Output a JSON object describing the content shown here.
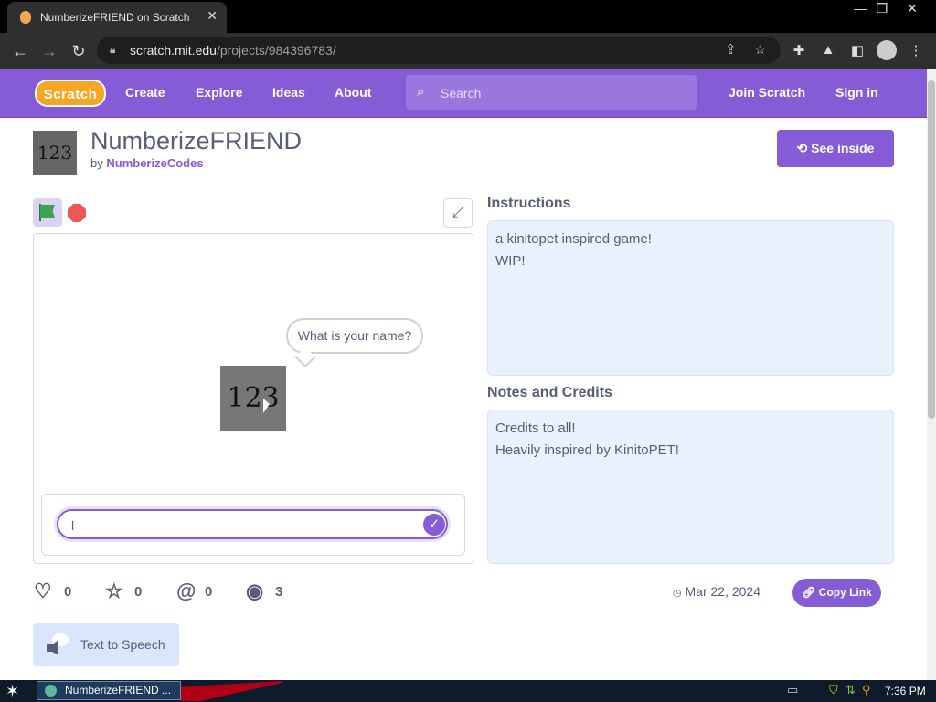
{
  "browser": {
    "tab_title": "NumberizeFRIEND on Scratch",
    "tab_close": "✕",
    "window_controls": [
      "—",
      "❐",
      "✕"
    ],
    "url_host": "scratch.mit.edu",
    "url_path": "/projects/984396783/"
  },
  "nav": {
    "logo": "Scratch",
    "links": [
      "Create",
      "Explore",
      "Ideas",
      "About"
    ],
    "search_placeholder": "Search",
    "join": "Join Scratch",
    "signin": "Sign in"
  },
  "project": {
    "thumbnail_text": "123",
    "title": "NumberizeFRIEND",
    "by_label": "by",
    "author": "NumberizeCodes",
    "see_inside": "See inside"
  },
  "stage": {
    "speech_bubble": "What is your name?",
    "sprite_text": "123",
    "ask_answer": "l"
  },
  "instructions": {
    "heading": "Instructions",
    "lines": [
      "a kinitopet inspired game!",
      "WIP!"
    ]
  },
  "notes": {
    "heading": "Notes and Credits",
    "lines": [
      "Credits to all!",
      "Heavily inspired by KinitoPET!"
    ]
  },
  "stats": {
    "loves": "0",
    "favorites": "0",
    "remixes": "0",
    "views": "3"
  },
  "shared_date": "Mar 22, 2024",
  "copy_link": "Copy Link",
  "text_to_speech": "Text to Speech",
  "taskbar": {
    "item_label": "NumberizeFRIEND ...",
    "clock": "7:36 PM"
  },
  "colors": {
    "scratch_purple": "#855cd6",
    "note_bg": "#e9f1fc",
    "text": "#575e75"
  }
}
